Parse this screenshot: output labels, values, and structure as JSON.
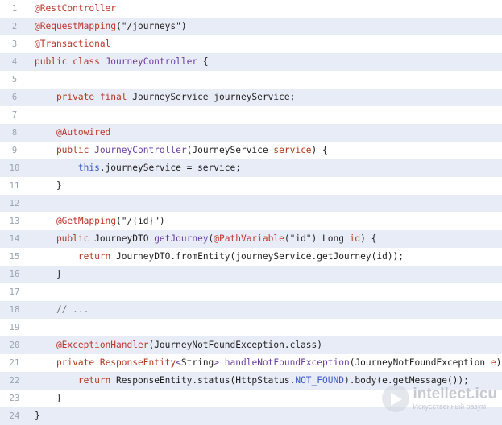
{
  "lines": [
    {
      "n": "1",
      "tokens": [
        {
          "t": "@RestController",
          "c": "ann"
        }
      ]
    },
    {
      "n": "2",
      "tokens": [
        {
          "t": "@RequestMapping",
          "c": "ann"
        },
        {
          "t": "(\"/journeys\")",
          "c": "plain"
        }
      ]
    },
    {
      "n": "3",
      "tokens": [
        {
          "t": "@Transactional",
          "c": "ann"
        }
      ]
    },
    {
      "n": "4",
      "tokens": [
        {
          "t": "public class ",
          "c": "kw"
        },
        {
          "t": "JourneyController",
          "c": "cls"
        },
        {
          "t": " {",
          "c": "plain"
        }
      ]
    },
    {
      "n": "5",
      "tokens": []
    },
    {
      "n": "6",
      "tokens": [
        {
          "t": "    private final ",
          "c": "kw"
        },
        {
          "t": "JourneyService journeyService;",
          "c": "plain"
        }
      ]
    },
    {
      "n": "7",
      "tokens": []
    },
    {
      "n": "8",
      "tokens": [
        {
          "t": "    @Autowired",
          "c": "ann"
        }
      ]
    },
    {
      "n": "9",
      "tokens": [
        {
          "t": "    public ",
          "c": "kw"
        },
        {
          "t": "JourneyController",
          "c": "fn"
        },
        {
          "t": "(JourneyService ",
          "c": "plain"
        },
        {
          "t": "service",
          "c": "var"
        },
        {
          "t": ") {",
          "c": "plain"
        }
      ]
    },
    {
      "n": "10",
      "tokens": [
        {
          "t": "        this",
          "c": "const"
        },
        {
          "t": ".journeyService = service;",
          "c": "plain"
        }
      ]
    },
    {
      "n": "11",
      "tokens": [
        {
          "t": "    }",
          "c": "plain"
        }
      ]
    },
    {
      "n": "12",
      "tokens": []
    },
    {
      "n": "13",
      "tokens": [
        {
          "t": "    @GetMapping",
          "c": "ann"
        },
        {
          "t": "(\"/{id}\")",
          "c": "plain"
        }
      ]
    },
    {
      "n": "14",
      "tokens": [
        {
          "t": "    public ",
          "c": "kw"
        },
        {
          "t": "JourneyDTO ",
          "c": "plain"
        },
        {
          "t": "getJourney",
          "c": "fn"
        },
        {
          "t": "(",
          "c": "plain"
        },
        {
          "t": "@PathVariable",
          "c": "ann"
        },
        {
          "t": "(\"id\") Long ",
          "c": "plain"
        },
        {
          "t": "id",
          "c": "var"
        },
        {
          "t": ") {",
          "c": "plain"
        }
      ]
    },
    {
      "n": "15",
      "tokens": [
        {
          "t": "        return ",
          "c": "kw"
        },
        {
          "t": "JourneyDTO.fromEntity(journeyService.getJourney(id));",
          "c": "plain"
        }
      ]
    },
    {
      "n": "16",
      "tokens": [
        {
          "t": "    }",
          "c": "plain"
        }
      ]
    },
    {
      "n": "17",
      "tokens": []
    },
    {
      "n": "18",
      "tokens": [
        {
          "t": "    // ...",
          "c": "cmt"
        }
      ]
    },
    {
      "n": "19",
      "tokens": []
    },
    {
      "n": "20",
      "tokens": [
        {
          "t": "    @ExceptionHandler",
          "c": "ann"
        },
        {
          "t": "(JourneyNotFoundException.class)",
          "c": "plain"
        }
      ]
    },
    {
      "n": "21",
      "tokens": [
        {
          "t": "    private ",
          "c": "kw"
        },
        {
          "t": "ResponseEntity",
          "c": "kw"
        },
        {
          "t": "<",
          "c": "cls"
        },
        {
          "t": "String",
          "c": "plain"
        },
        {
          "t": "> ",
          "c": "cls"
        },
        {
          "t": "handleNotFoundException",
          "c": "fn"
        },
        {
          "t": "(JourneyNotFoundException ",
          "c": "plain"
        },
        {
          "t": "e",
          "c": "var"
        },
        {
          "t": ") {",
          "c": "plain"
        }
      ]
    },
    {
      "n": "22",
      "tokens": [
        {
          "t": "        return ",
          "c": "kw"
        },
        {
          "t": "ResponseEntity.status(HttpStatus.",
          "c": "plain"
        },
        {
          "t": "NOT_FOUND",
          "c": "const"
        },
        {
          "t": ").body(e.getMessage());",
          "c": "plain"
        }
      ]
    },
    {
      "n": "23",
      "tokens": [
        {
          "t": "    }",
          "c": "plain"
        }
      ]
    },
    {
      "n": "24",
      "tokens": [
        {
          "t": "}",
          "c": "plain"
        }
      ]
    }
  ],
  "watermark": {
    "title": "intellect.icu",
    "subtitle": "Искусственный разум"
  }
}
